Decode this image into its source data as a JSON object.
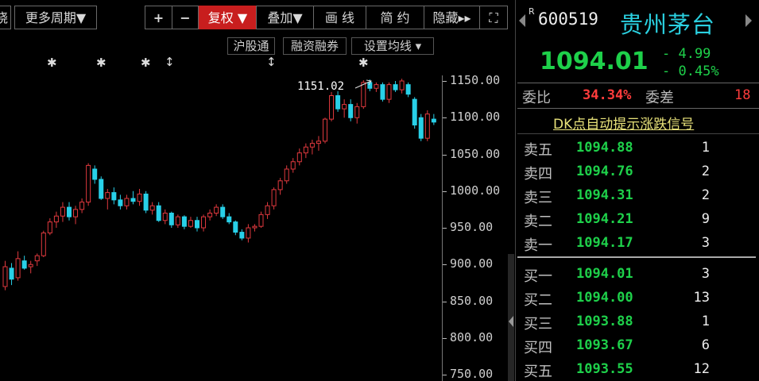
{
  "toolbar": {
    "left_partial": "晓",
    "period": "更多周期▼",
    "plus": "+",
    "minus": "−",
    "fuquan": "复权 ▼",
    "diejia": "叠加▼",
    "huaxian": "画 线",
    "jianyue": "简 约",
    "yincang": "隐藏▸▸",
    "fullscreen": "⛶"
  },
  "subtoolbar": {
    "hgt": "沪股通",
    "rzrq": "融资融券",
    "junxian": "设置均线 ▾"
  },
  "chart": {
    "peak_label": "1151.02",
    "price_labels": [
      "1150.00",
      "1100.00",
      "1050.00",
      "1000.00",
      "950.00",
      "900.00",
      "850.00",
      "800.00",
      "750.00"
    ],
    "up_color": "#e0393e",
    "down_color": "#28d0e8"
  },
  "chart_data": {
    "type": "candlestick",
    "ylim": [
      750,
      1150
    ],
    "candles": [
      {
        "o": 870,
        "h": 905,
        "l": 865,
        "c": 897
      },
      {
        "o": 895,
        "h": 902,
        "l": 872,
        "c": 880
      },
      {
        "o": 882,
        "h": 918,
        "l": 878,
        "c": 908
      },
      {
        "o": 905,
        "h": 912,
        "l": 893,
        "c": 895
      },
      {
        "o": 897,
        "h": 905,
        "l": 888,
        "c": 900
      },
      {
        "o": 905,
        "h": 915,
        "l": 898,
        "c": 912
      },
      {
        "o": 912,
        "h": 946,
        "l": 910,
        "c": 943
      },
      {
        "o": 943,
        "h": 963,
        "l": 940,
        "c": 958
      },
      {
        "o": 958,
        "h": 972,
        "l": 950,
        "c": 966
      },
      {
        "o": 966,
        "h": 985,
        "l": 958,
        "c": 978
      },
      {
        "o": 978,
        "h": 985,
        "l": 960,
        "c": 965
      },
      {
        "o": 965,
        "h": 980,
        "l": 955,
        "c": 975
      },
      {
        "o": 975,
        "h": 990,
        "l": 970,
        "c": 985
      },
      {
        "o": 985,
        "h": 1038,
        "l": 980,
        "c": 1035
      },
      {
        "o": 1030,
        "h": 1035,
        "l": 1010,
        "c": 1016
      },
      {
        "o": 1016,
        "h": 1020,
        "l": 988,
        "c": 990
      },
      {
        "o": 990,
        "h": 1003,
        "l": 975,
        "c": 998
      },
      {
        "o": 998,
        "h": 1005,
        "l": 982,
        "c": 988
      },
      {
        "o": 988,
        "h": 995,
        "l": 975,
        "c": 980
      },
      {
        "o": 980,
        "h": 995,
        "l": 975,
        "c": 990
      },
      {
        "o": 990,
        "h": 1000,
        "l": 982,
        "c": 986
      },
      {
        "o": 986,
        "h": 1003,
        "l": 980,
        "c": 996
      },
      {
        "o": 996,
        "h": 1000,
        "l": 970,
        "c": 974
      },
      {
        "o": 974,
        "h": 985,
        "l": 968,
        "c": 980
      },
      {
        "o": 980,
        "h": 985,
        "l": 958,
        "c": 960
      },
      {
        "o": 960,
        "h": 975,
        "l": 955,
        "c": 970
      },
      {
        "o": 970,
        "h": 972,
        "l": 950,
        "c": 954
      },
      {
        "o": 954,
        "h": 968,
        "l": 950,
        "c": 965
      },
      {
        "o": 965,
        "h": 967,
        "l": 948,
        "c": 952
      },
      {
        "o": 952,
        "h": 965,
        "l": 950,
        "c": 960
      },
      {
        "o": 960,
        "h": 965,
        "l": 945,
        "c": 950
      },
      {
        "o": 950,
        "h": 968,
        "l": 945,
        "c": 965
      },
      {
        "o": 965,
        "h": 975,
        "l": 960,
        "c": 970
      },
      {
        "o": 970,
        "h": 982,
        "l": 966,
        "c": 978
      },
      {
        "o": 978,
        "h": 982,
        "l": 962,
        "c": 965
      },
      {
        "o": 965,
        "h": 970,
        "l": 955,
        "c": 958
      },
      {
        "o": 958,
        "h": 960,
        "l": 940,
        "c": 944
      },
      {
        "o": 944,
        "h": 948,
        "l": 933,
        "c": 936
      },
      {
        "o": 936,
        "h": 955,
        "l": 930,
        "c": 950
      },
      {
        "o": 950,
        "h": 955,
        "l": 945,
        "c": 952
      },
      {
        "o": 952,
        "h": 972,
        "l": 950,
        "c": 968
      },
      {
        "o": 968,
        "h": 985,
        "l": 962,
        "c": 980
      },
      {
        "o": 980,
        "h": 1005,
        "l": 975,
        "c": 1002
      },
      {
        "o": 1002,
        "h": 1018,
        "l": 995,
        "c": 1014
      },
      {
        "o": 1014,
        "h": 1035,
        "l": 1010,
        "c": 1030
      },
      {
        "o": 1030,
        "h": 1045,
        "l": 1025,
        "c": 1040
      },
      {
        "o": 1040,
        "h": 1058,
        "l": 1035,
        "c": 1052
      },
      {
        "o": 1052,
        "h": 1065,
        "l": 1045,
        "c": 1060
      },
      {
        "o": 1060,
        "h": 1070,
        "l": 1050,
        "c": 1065
      },
      {
        "o": 1065,
        "h": 1075,
        "l": 1055,
        "c": 1068
      },
      {
        "o": 1068,
        "h": 1100,
        "l": 1065,
        "c": 1098
      },
      {
        "o": 1098,
        "h": 1135,
        "l": 1095,
        "c": 1130
      },
      {
        "o": 1130,
        "h": 1136,
        "l": 1108,
        "c": 1112
      },
      {
        "o": 1112,
        "h": 1125,
        "l": 1100,
        "c": 1118
      },
      {
        "o": 1118,
        "h": 1125,
        "l": 1095,
        "c": 1100
      },
      {
        "o": 1100,
        "h": 1120,
        "l": 1092,
        "c": 1115
      },
      {
        "o": 1115,
        "h": 1151,
        "l": 1112,
        "c": 1148
      },
      {
        "o": 1148,
        "h": 1152,
        "l": 1136,
        "c": 1140
      },
      {
        "o": 1140,
        "h": 1148,
        "l": 1135,
        "c": 1145
      },
      {
        "o": 1145,
        "h": 1148,
        "l": 1122,
        "c": 1125
      },
      {
        "o": 1125,
        "h": 1148,
        "l": 1120,
        "c": 1145
      },
      {
        "o": 1145,
        "h": 1150,
        "l": 1135,
        "c": 1138
      },
      {
        "o": 1138,
        "h": 1153,
        "l": 1133,
        "c": 1150
      },
      {
        "o": 1145,
        "h": 1148,
        "l": 1128,
        "c": 1132
      },
      {
        "o": 1125,
        "h": 1128,
        "l": 1085,
        "c": 1090
      },
      {
        "o": 1100,
        "h": 1105,
        "l": 1068,
        "c": 1072
      },
      {
        "o": 1072,
        "h": 1110,
        "l": 1068,
        "c": 1105
      },
      {
        "o": 1098,
        "h": 1105,
        "l": 1090,
        "c": 1094
      }
    ]
  },
  "stock": {
    "superscript": "R",
    "code": "600519",
    "name": "贵州茅台",
    "price": "1094.01",
    "change": "- 4.99",
    "change_pct": "- 0.45%",
    "weibi_label": "委比",
    "weibi_value": "34.34%",
    "weicha_label": "委差",
    "weicha_value": "18",
    "dk_link": "DK点自动提示涨跌信号"
  },
  "orderbook": {
    "asks": [
      {
        "name": "卖五",
        "price": "1094.88",
        "vol": "1"
      },
      {
        "name": "卖四",
        "price": "1094.76",
        "vol": "2"
      },
      {
        "name": "卖三",
        "price": "1094.31",
        "vol": "2"
      },
      {
        "name": "卖二",
        "price": "1094.21",
        "vol": "9"
      },
      {
        "name": "卖一",
        "price": "1094.17",
        "vol": "3"
      }
    ],
    "bids": [
      {
        "name": "买一",
        "price": "1094.01",
        "vol": "3"
      },
      {
        "name": "买二",
        "price": "1094.00",
        "vol": "13"
      },
      {
        "name": "买三",
        "price": "1093.88",
        "vol": "1"
      },
      {
        "name": "买四",
        "price": "1093.67",
        "vol": "6"
      },
      {
        "name": "买五",
        "price": "1093.55",
        "vol": "12"
      }
    ]
  }
}
